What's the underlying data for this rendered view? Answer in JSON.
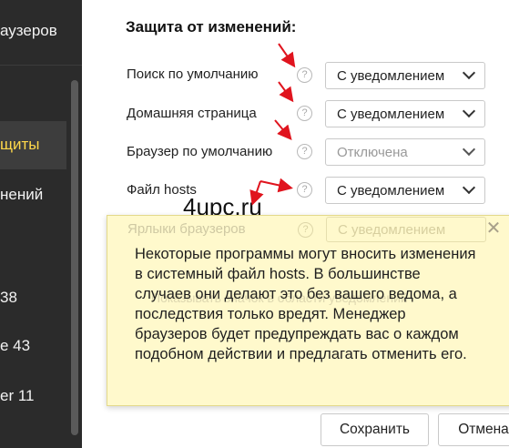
{
  "sidebar": {
    "title": "аузеров",
    "active_item": "щиты",
    "items": [
      "нений",
      "38",
      "e 43",
      "er 11"
    ]
  },
  "settings": {
    "section_title": "Защита от изменений:",
    "rows": [
      {
        "label": "Поиск по умолчанию",
        "value": "С уведомлением",
        "disabled": false
      },
      {
        "label": "Домашняя страница",
        "value": "С уведомлением",
        "disabled": false
      },
      {
        "label": "Браузер по умолчанию",
        "value": "Отключена",
        "disabled": true
      },
      {
        "label": "Файл hosts",
        "value": "С уведомлением",
        "disabled": false
      },
      {
        "label": "Ярлыки браузеров",
        "value": "С уведомлением",
        "disabled": false
      }
    ],
    "help_glyph": "?"
  },
  "watermark": "4upc.ru",
  "tooltip": {
    "text": "Некоторые программы могут вносить изменения в системный файл hosts. В большинстве случаев они делают это без вашего ведома, а последствия только вредят. Менеджер браузеров будет предупреждать вас о каждом подобном действии и предлагать отменить его.",
    "ghost_text": "Показывать значок в области уведомлений",
    "close_glyph": "✕"
  },
  "buttons": {
    "save": "Сохранить",
    "cancel": "Отмена"
  },
  "colors": {
    "sidebar_bg": "#2b2b2b",
    "sidebar_active_text": "#ffd84a",
    "tooltip_bg": "#fff9cc",
    "arrow_red": "#e0141e"
  }
}
